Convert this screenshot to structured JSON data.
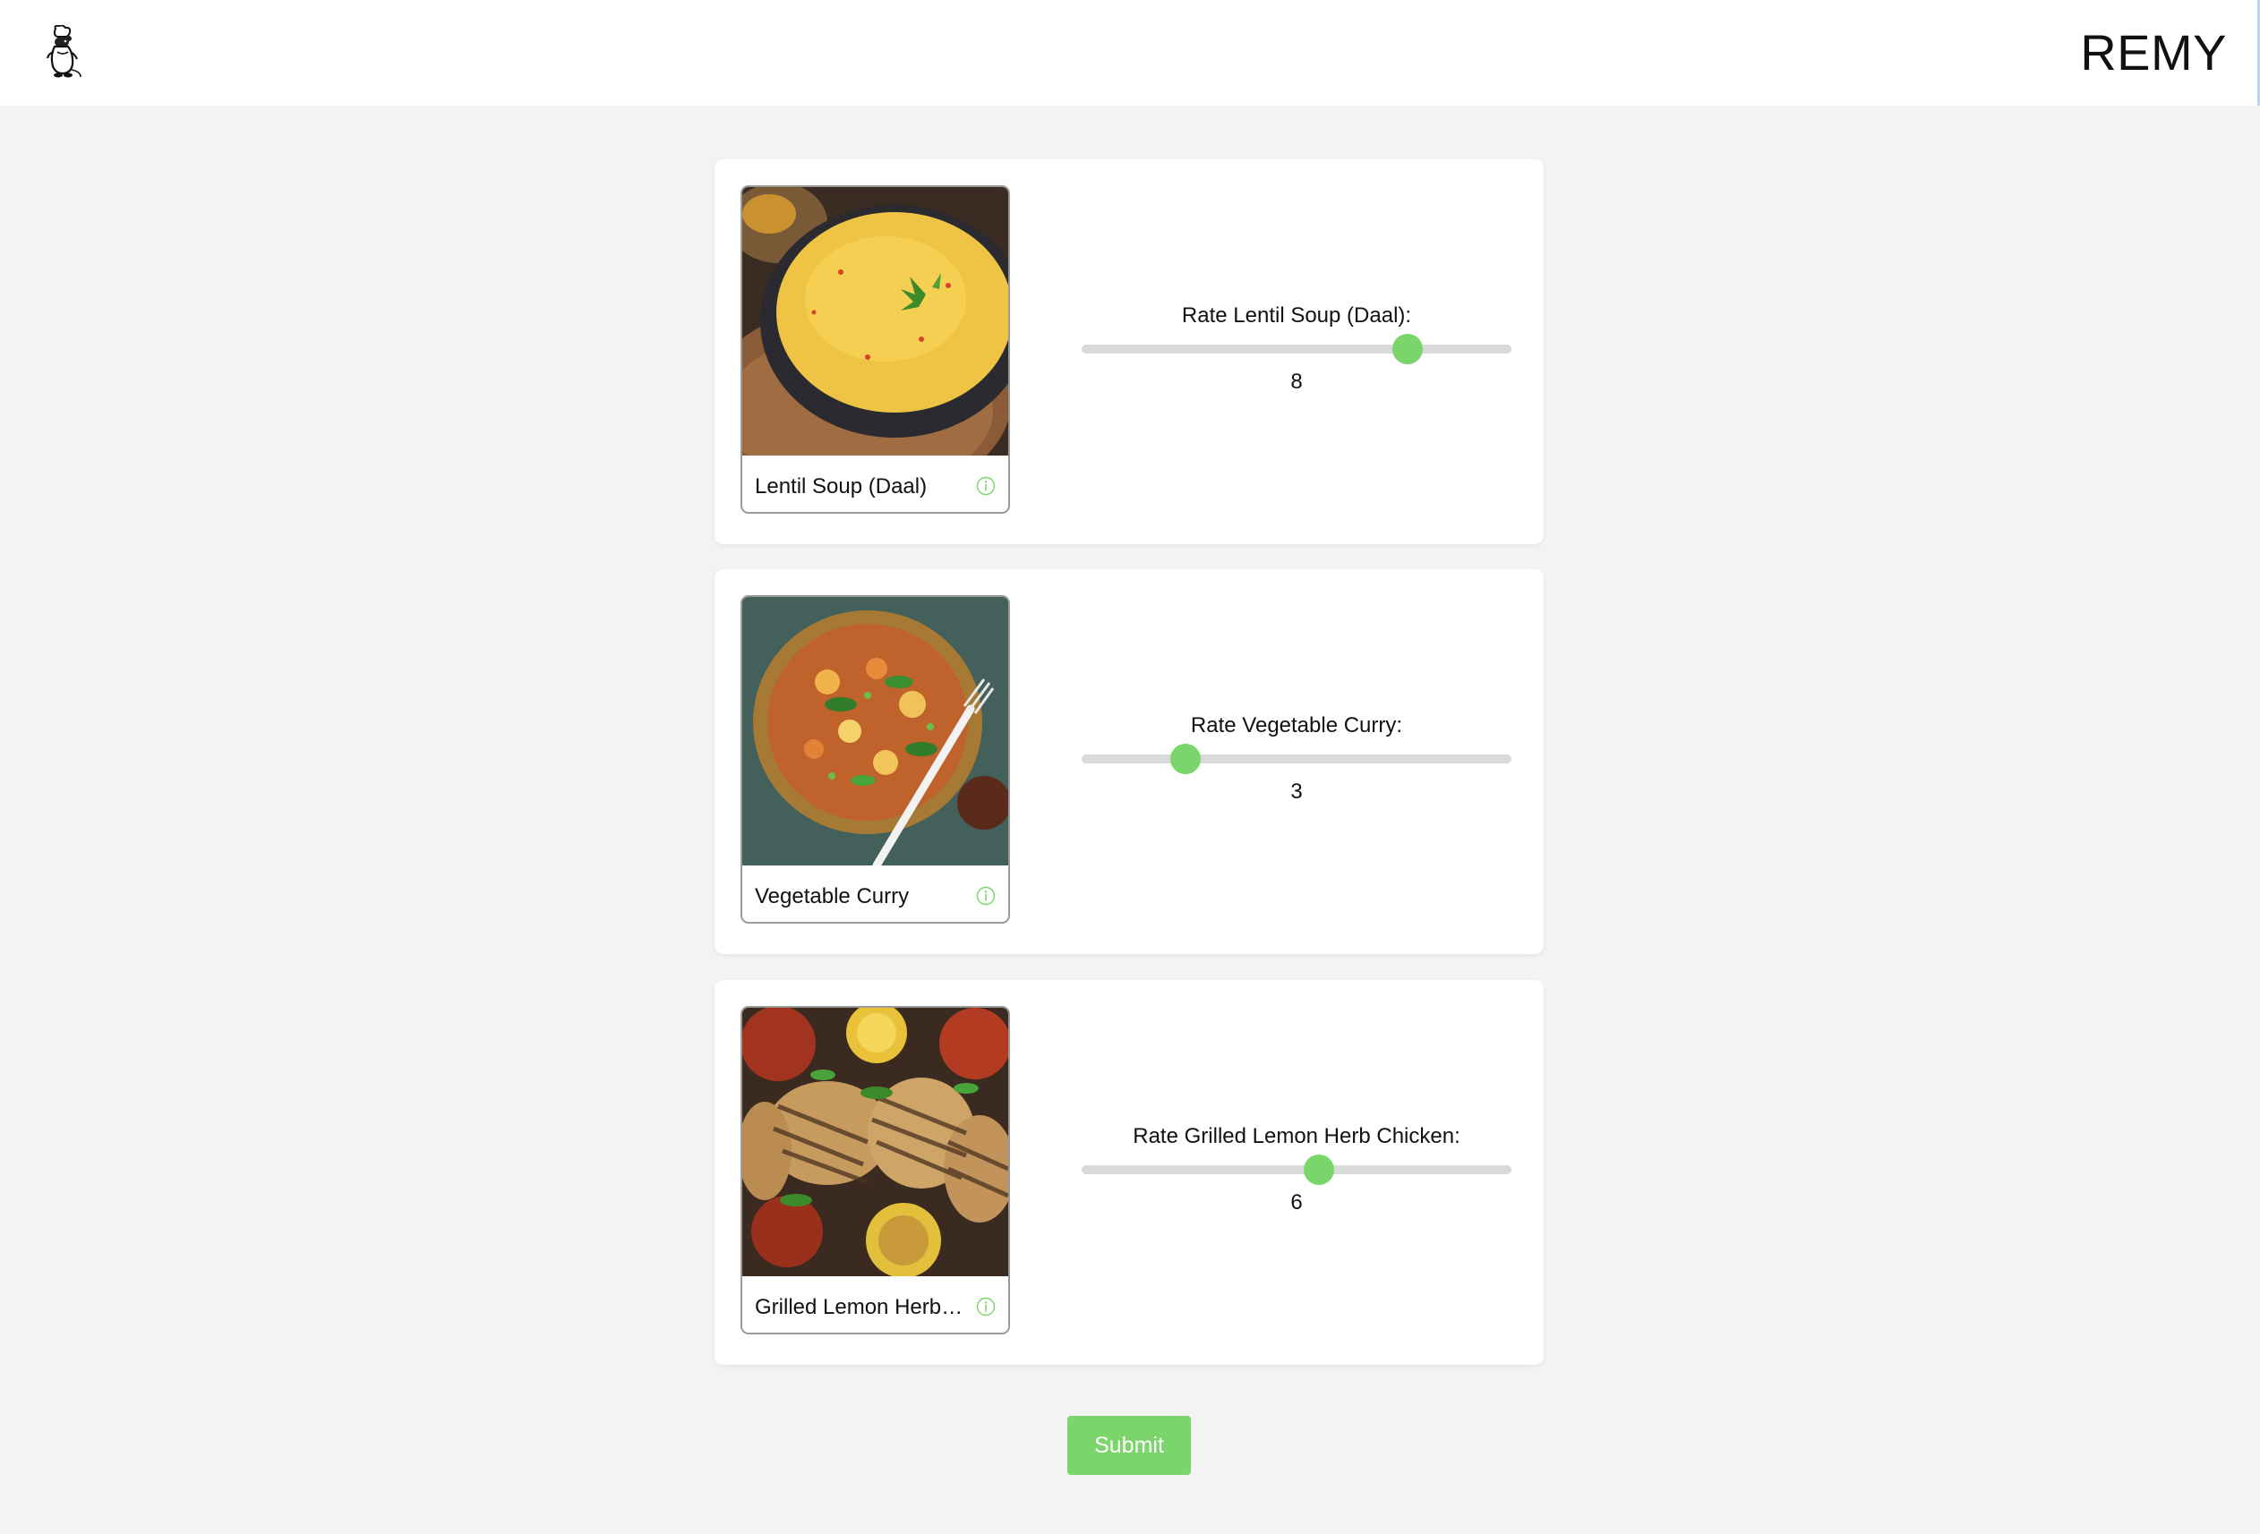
{
  "header": {
    "brand": "REMY",
    "logo_icon": "chef-rat-icon"
  },
  "dishes": [
    {
      "name": "Lentil Soup (Daal)",
      "rating_label": "Rate Lentil Soup (Daal):",
      "rating": 8,
      "rating_min": 1,
      "rating_max": 10,
      "photo": "lentil-soup-photo"
    },
    {
      "name": "Vegetable Curry",
      "rating_label": "Rate Vegetable Curry:",
      "rating": 3,
      "rating_min": 1,
      "rating_max": 10,
      "photo": "vegetable-curry-photo"
    },
    {
      "name": "Grilled Lemon Herb Chicken",
      "rating_label": "Rate Grilled Lemon Herb Chicken:",
      "rating": 6,
      "rating_min": 1,
      "rating_max": 10,
      "photo": "grilled-chicken-photo"
    }
  ],
  "submit_label": "Submit",
  "colors": {
    "accent": "#7ad56a",
    "track": "#d9d9d9",
    "background": "#f3f3f3"
  }
}
